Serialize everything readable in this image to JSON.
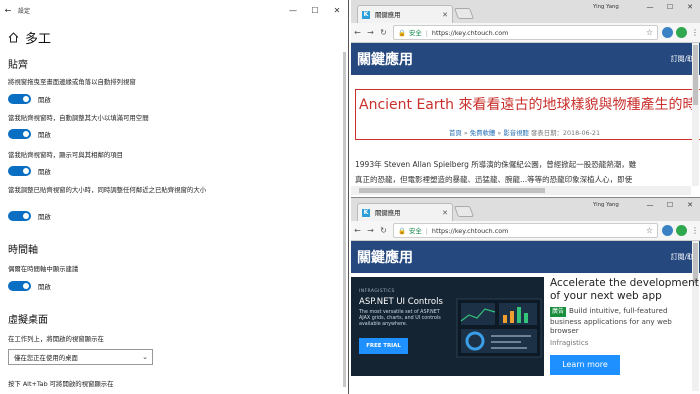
{
  "settings": {
    "title": "設定",
    "page_title": "多工",
    "sections": {
      "snap": {
        "title": "貼齊",
        "items": [
          {
            "desc": "將視窗拖曳至畫面邊緣或角落以自動排列視窗",
            "state": "開啟"
          },
          {
            "desc": "當我貼齊視窗時，自動調整其大小以填滿可用空間",
            "state": "開啟"
          },
          {
            "desc": "當我貼齊視窗時，顯示可與其相鄰的項目",
            "state": "開啟"
          },
          {
            "desc": "當我調整已貼齊視窗的大小時，同時調整任何鄰近之已貼齊視窗的大小",
            "state": "開啟"
          }
        ]
      },
      "timeline": {
        "title": "時間軸",
        "items": [
          {
            "desc": "偶爾在時間軸中顯示建議",
            "state": "開啟"
          }
        ]
      },
      "virtual_desktops": {
        "title": "虛擬桌面",
        "taskbar_desc": "在工作列上，將開啟的視窗顯示在",
        "taskbar_value": "僅在您正在使用的桌面",
        "alt_tab_desc": "按下 Alt+Tab 可將開啟的視窗顯示在"
      }
    }
  },
  "browser": {
    "tab_title": "關鍵應用",
    "favicon": "K",
    "user": "Ying Yang",
    "secure_label": "安全",
    "url": "https://key.chtouch.com",
    "site_logo": "關鍵應用",
    "site_nav": "訂閱/取",
    "colors": {
      "header": "#25487f",
      "accent": "#c9302c"
    }
  },
  "article": {
    "title": "Ancient Earth 來看看遠古的地球樣貌與物種產生的時",
    "breadcrumb_home": "首頁",
    "breadcrumb_sep": " » ",
    "breadcrumb_cat1": "免費軟體",
    "breadcrumb_cat2": "影音視聽",
    "published": "發表日期：2018-06-21",
    "body_line1": "1993年 Steven Allan Spielberg 所導演的侏儸紀公園，曾經掀起一股恐龍熱潮，雖",
    "body_line2": "真正的恐龍，但電影裡塑造的暴龍、迅猛龍、腕龍...等等的恐龍印象深植人心，即使"
  },
  "ad": {
    "brand": "INFRAGISTICS",
    "product": "ASP.NET UI Controls",
    "desc": "The most versatile set of ASP.NET AJAX grids, charts, and UI controls available anywhere.",
    "trial": "FREE TRIAL",
    "headline": "Accelerate the development of your next web app",
    "tag": "廣告",
    "body": "Build intuitive, full-featured business applications for any web browser",
    "source": "Infragistics",
    "cta": "Learn more"
  }
}
